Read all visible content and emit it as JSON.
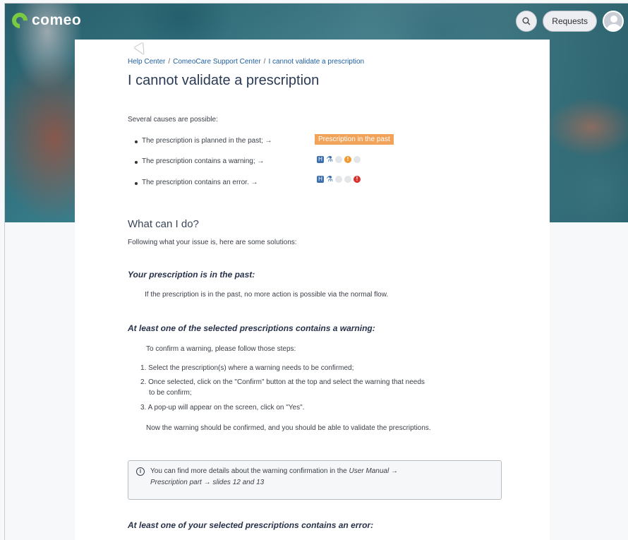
{
  "header": {
    "logo_text": "comeo",
    "search_icon": "search-icon",
    "requests_label": "Requests",
    "avatar_icon": "user-avatar-icon",
    "brand_color": "#7ac943"
  },
  "breadcrumb": {
    "items": [
      "Help Center",
      "ComeoCare Support Center",
      "I cannot validate a prescription"
    ],
    "separator": "/"
  },
  "article": {
    "title": "I cannot validate a prescription",
    "intro": "Several causes are possible:",
    "causes": [
      "The prescription is planned in the past;  →",
      "The prescription contains a warning;  →",
      "The prescription contains an error.    →"
    ],
    "past_badge": "Prescription in the past",
    "what_heading": "What can I do?",
    "what_intro": "Following what your issue is, here are some solutions:",
    "section_past": {
      "heading": "Your prescription is in the past:",
      "text": "If the prescription is in the past, no more action is possible via the normal flow."
    },
    "section_warning": {
      "heading": "At least one of the selected prescriptions contains a warning:",
      "intro": "To confirm a warning, please follow those steps:",
      "steps": [
        "1. Select the prescription(s) where a warning needs to be confirmed;",
        "2. Once selected, click on the \"Confirm\" button at the top and select the warning that needs",
        "to be confirm;",
        "3. A pop-up will appear on the screen, click on \"Yes\"."
      ],
      "outro": "Now the warning should be confirmed, and you should be able to validate the prescriptions."
    },
    "info_box": {
      "line1_prefix": "You can find more details about the warning confirmation in the ",
      "line1_em": "User Manual →",
      "line2": "Prescription part → slides 12 and 13"
    },
    "section_error": {
      "heading": "At least one of your selected prescriptions contains an error:"
    }
  },
  "colors": {
    "accent_orange": "#f2a35a",
    "warning_orange": "#f0982f",
    "error_red": "#d9302c",
    "link_blue": "#1f5fa0"
  }
}
